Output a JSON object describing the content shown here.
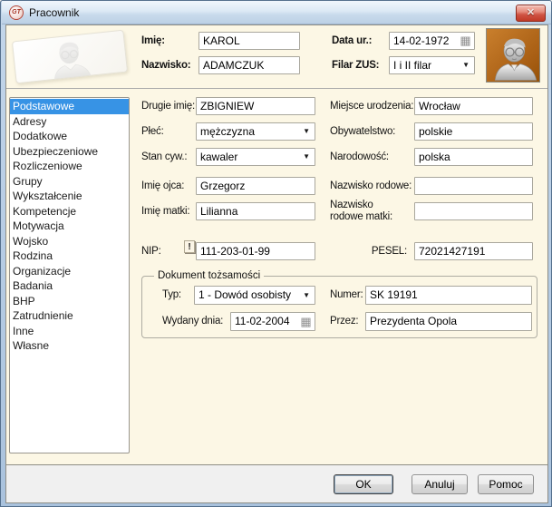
{
  "window": {
    "title": "Pracownik",
    "icon_text": "GT"
  },
  "icons": {
    "close": "✕",
    "dropdown": "▼",
    "calendar": "▦",
    "warning": "!"
  },
  "colors": {
    "selection_blue": "#3793E5",
    "content_cream": "#FCF7E5",
    "avatar_orange": "#A95F14"
  },
  "header": {
    "imie_label": "Imię:",
    "imie_value": "KAROL",
    "nazwisko_label": "Nazwisko:",
    "nazwisko_value": "ADAMCZUK",
    "data_ur_label": "Data ur.:",
    "data_ur_value": "14-02-1972",
    "filar_label": "Filar ZUS:",
    "filar_value": "I i II filar"
  },
  "sidebar": {
    "selected_index": 0,
    "items": [
      "Podstawowe",
      "Adresy",
      "Dodatkowe",
      "Ubezpieczeniowe",
      "Rozliczeniowe",
      "Grupy",
      "Wykształcenie",
      "Kompetencje",
      "Motywacja",
      "Wojsko",
      "Rodzina",
      "Organizacje",
      "Badania",
      "BHP",
      "Zatrudnienie",
      "Inne",
      "Własne"
    ]
  },
  "form": {
    "drugie_imie_label": "Drugie imię:",
    "drugie_imie_value": "ZBIGNIEW",
    "plec_label": "Płeć:",
    "plec_value": "mężczyzna",
    "stan_label": "Stan cyw.:",
    "stan_value": "kawaler",
    "imie_ojca_label": "Imię ojca:",
    "imie_ojca_value": "Grzegorz",
    "imie_matki_label": "Imię matki:",
    "imie_matki_value": "Lilianna",
    "nip_label": "NIP:",
    "nip_value": "111-203-01-99",
    "miejsce_label": "Miejsce urodzenia:",
    "miejsce_value": "Wrocław",
    "obywatelstwo_label": "Obywatelstwo:",
    "obywatelstwo_value": "polskie",
    "narodowosc_label": "Narodowość:",
    "narodowosc_value": "polska",
    "nazwisko_rodowe_label": "Nazwisko rodowe:",
    "nazwisko_rodowe_value": "",
    "nazwisko_rodowe_matki_label": "Nazwisko rodowe matki:",
    "nazwisko_rodowe_matki_value": "",
    "pesel_label": "PESEL:",
    "pesel_value": "72021427191"
  },
  "dokument": {
    "title": "Dokument tożsamości",
    "typ_label": "Typ:",
    "typ_value": "1 - Dowód osobisty",
    "numer_label": "Numer:",
    "numer_value": "SK 19191",
    "wydany_label": "Wydany dnia:",
    "wydany_value": "11-02-2004",
    "przez_label": "Przez:",
    "przez_value": "Prezydenta Opola"
  },
  "footer": {
    "ok": "OK",
    "anuluj": "Anuluj",
    "pomoc": "Pomoc"
  }
}
